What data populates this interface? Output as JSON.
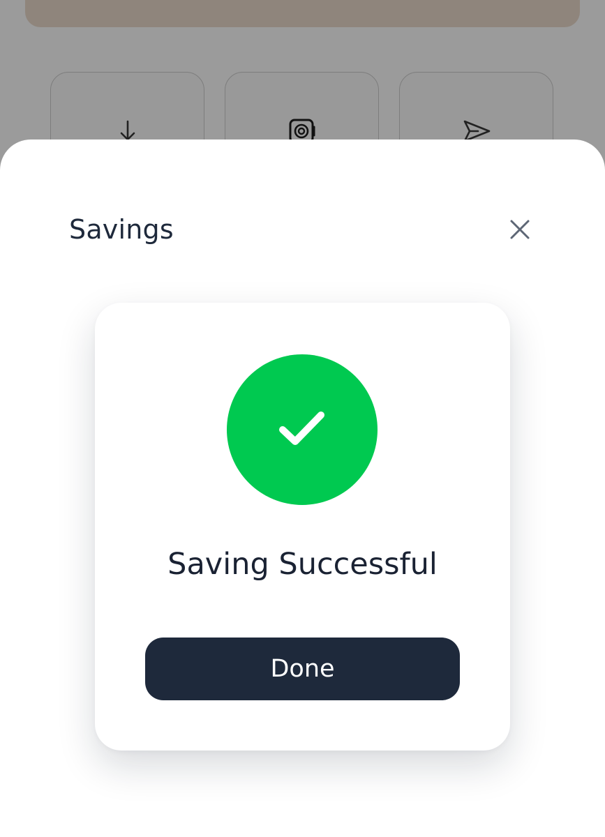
{
  "background": {
    "actions": [
      {
        "icon": "arrow-down-icon"
      },
      {
        "icon": "safe-icon"
      },
      {
        "icon": "send-icon"
      }
    ]
  },
  "sheet": {
    "title": "Savings",
    "close_icon": "close-icon"
  },
  "success": {
    "icon": "checkmark-icon",
    "message": "Saving Successful",
    "done_label": "Done",
    "accent_color": "#00c950",
    "button_color": "#1e293b"
  }
}
